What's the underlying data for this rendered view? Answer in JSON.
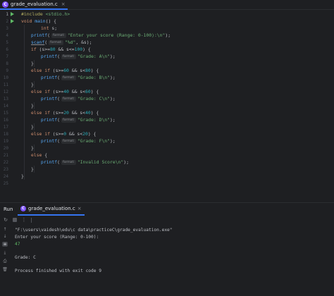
{
  "editor_tab": {
    "icon": "C",
    "label": "grade_evaluation.c",
    "close": "×"
  },
  "line_numbers": [
    "1",
    "2",
    "3",
    "4",
    "5",
    "6",
    "7",
    "8",
    "9",
    "10",
    "11",
    "12",
    "13",
    "14",
    "15",
    "16",
    "17",
    "18",
    "19",
    "20",
    "21",
    "22",
    "23",
    "24",
    "25"
  ],
  "code": {
    "l1": {
      "pp": "#include",
      "header": " <stdio.h>"
    },
    "l2": {
      "kw": "void",
      "fn": " main",
      "rest": "() {"
    },
    "l3": {
      "kw": "int",
      "rest": " s;"
    },
    "l4": {
      "fn": "printf",
      "open": "(",
      "hint": "format:",
      "str": "\"Enter your score (Range: 0-100):\\n\"",
      "close": ");"
    },
    "l5": {
      "fn": "scanf",
      "open": "(",
      "hint": "format:",
      "str": "\"%d\"",
      "close": ", &s);"
    },
    "l6": {
      "kw": "if",
      "a": " (s>=",
      "n1": "80",
      "b": " && s<=",
      "n2": "100",
      "c": ") {"
    },
    "l7": {
      "fn": "printf",
      "open": "(",
      "hint": "format:",
      "str": "\"Grade: A\\n\"",
      "close": ");"
    },
    "l8": {
      "rest": "}"
    },
    "l9": {
      "kw": "else if",
      "a": " (s>=",
      "n1": "60",
      "b": " && s<",
      "n2": "80",
      "c": ") {"
    },
    "l10": {
      "fn": "printf",
      "open": "(",
      "hint": "format:",
      "str": "\"Grade: B\\n\"",
      "close": ");"
    },
    "l11": {
      "rest": "}"
    },
    "l12": {
      "kw": "else if",
      "a": " (s>=",
      "n1": "40",
      "b": " && s<",
      "n2": "60",
      "c": ") {"
    },
    "l13": {
      "fn": "printf",
      "open": "(",
      "hint": "format:",
      "str": "\"Grade: C\\n\"",
      "close": ");"
    },
    "l14": {
      "rest": "}"
    },
    "l15": {
      "kw": "else if",
      "a": " (s>=",
      "n1": "20",
      "b": " && s<",
      "n2": "40",
      "c": ") {"
    },
    "l16": {
      "fn": "printf",
      "open": "(",
      "hint": "format:",
      "str": "\"Grade: D\\n\"",
      "close": ");"
    },
    "l17": {
      "rest": "}"
    },
    "l18": {
      "kw": "else if",
      "a": " (s>=",
      "n1": "0",
      "b": " && s<",
      "n2": "20",
      "c": ") {"
    },
    "l19": {
      "fn": "printf",
      "open": "(",
      "hint": "format:",
      "str": "\"Grade: F\\n\"",
      "close": ");"
    },
    "l20": {
      "rest": "}"
    },
    "l21": {
      "kw": "else",
      "rest": " {"
    },
    "l22": {
      "fn": "printf",
      "open": "(",
      "hint": "format:",
      "str": "\"Invalid Score\\n\"",
      "close": ");"
    },
    "l23": {
      "rest": "}"
    },
    "l24": {
      "rest": "}"
    }
  },
  "run_panel": {
    "title": "Run",
    "tab_icon": "C",
    "tab_label": "grade_evaluation.c",
    "tab_close": "×"
  },
  "toolbar": {
    "rerun": "↻",
    "more": "⋮"
  },
  "side_icons": {
    "up": "↑",
    "down": "↓",
    "wrap": "≡",
    "scroll": "⤓",
    "print": "⎙",
    "trash": "🗑"
  },
  "console": {
    "command": "\"F:\\users\\vaidesh\\edu\\c data\\practiceC\\grade_evaluation.exe\"",
    "prompt": "Enter your score (Range: 0-100):",
    "input": "47",
    "blank": "",
    "result": "Grade: C",
    "exit": "Process finished with exit code 9"
  },
  "colors": {
    "background": "#1e1f22",
    "keyword": "#cf8e6d",
    "string": "#6aab73",
    "number": "#2aacb8",
    "function": "#56a8f5",
    "accent": "#3574f0",
    "run_green": "#5fb865"
  }
}
